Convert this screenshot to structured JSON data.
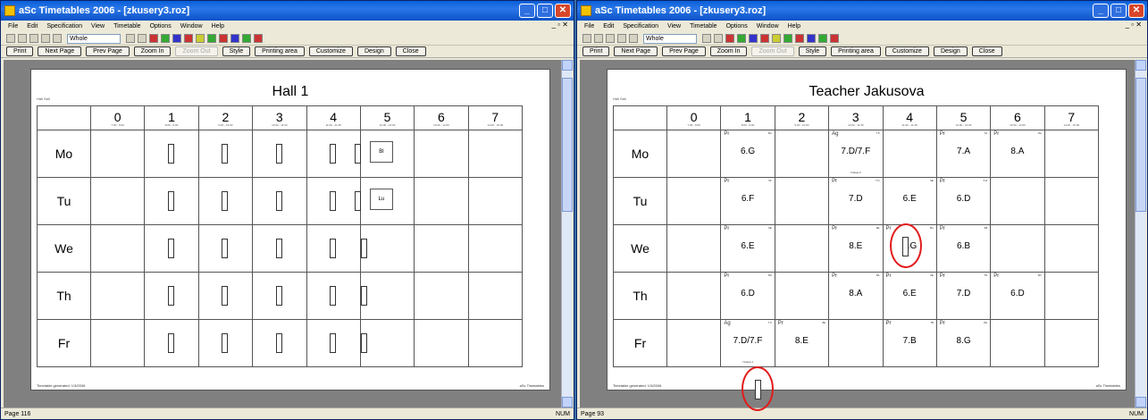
{
  "w1": {
    "title": "aSc Timetables 2006 - [zkusery3.roz]",
    "menu": [
      "File",
      "Edit",
      "Specification",
      "View",
      "Timetable",
      "Options",
      "Window",
      "Help"
    ],
    "combo": "Whole",
    "buttons": [
      "Print",
      "Next Page",
      "Prev Page",
      "Zoom In",
      "Zoom Out",
      "Style",
      "Printing area",
      "Customize",
      "Design",
      "Close"
    ],
    "status_left": "Page 116",
    "status_right": "NUM",
    "page": {
      "title": "Hall 1",
      "subtitle": "Hall Sali",
      "columns": [
        {
          "num": "0",
          "time": "7:00 - 8:00"
        },
        {
          "num": "1",
          "time": "8:00 - 9:00"
        },
        {
          "num": "2",
          "time": "9:00 - 10:00"
        },
        {
          "num": "3",
          "time": "10:00 - 11:00"
        },
        {
          "num": "4",
          "time": "11:00 - 11:45"
        },
        {
          "num": "5",
          "time": "12:00 - 13:00"
        },
        {
          "num": "6",
          "time": "13:00 - 14:00"
        },
        {
          "num": "7",
          "time": "14:00 - 15:00"
        }
      ],
      "rows": [
        {
          "day": "Mo",
          "cells": [
            "",
            "Wi",
            "Mg",
            "Fr",
            "Lp",
            "He",
            "Bl",
            "",
            ""
          ]
        },
        {
          "day": "Tu",
          "cells": [
            "",
            "Gy",
            "Bo",
            "Ch",
            "Mr",
            "Jk",
            "Lu",
            "",
            ""
          ]
        },
        {
          "day": "We",
          "cells": [
            "",
            "Wi",
            "Lp",
            "Mr",
            "Tm",
            "Fe",
            "",
            "",
            ""
          ]
        },
        {
          "day": "Th",
          "cells": [
            "",
            "Hg",
            "Kl",
            "Fr",
            "Bl",
            "Mi",
            "",
            "",
            ""
          ]
        },
        {
          "day": "Fr",
          "cells": [
            "",
            "Bo",
            "Hu",
            "Kl",
            "Sv",
            "Hn",
            "",
            "",
            ""
          ]
        }
      ],
      "footer_left": "Timetable generated: 1/3/2006",
      "footer_right": "aSc Timetables"
    }
  },
  "w2": {
    "title": "aSc Timetables 2006 - [zkusery3.roz]",
    "menu": [
      "File",
      "Edit",
      "Specification",
      "View",
      "Timetable",
      "Options",
      "Window",
      "Help"
    ],
    "combo": "Whole",
    "buttons": [
      "Print",
      "Next Page",
      "Prev Page",
      "Zoom In",
      "Zoom Out",
      "Style",
      "Printing area",
      "Customize",
      "Design",
      "Close"
    ],
    "status_left": "Page 93",
    "status_right": "NUM",
    "page": {
      "title": "Teacher Jakusova",
      "subtitle": "Hall Sali",
      "columns": [
        {
          "num": "0",
          "time": "7:00 - 8:00"
        },
        {
          "num": "1",
          "time": "8:00 - 9:00"
        },
        {
          "num": "2",
          "time": "9:00 - 10:00"
        },
        {
          "num": "3",
          "time": "10:00 - 11:00"
        },
        {
          "num": "4",
          "time": "11:00 - 11:45"
        },
        {
          "num": "5",
          "time": "12:00 - 13:00"
        },
        {
          "num": "6",
          "time": "13:00 - 14:00"
        },
        {
          "num": "7",
          "time": "14:00 - 15:00"
        }
      ],
      "rows": [
        {
          "day": "Mo",
          "cells": [
            {
              "s": "",
              "r": "",
              "c": "",
              "m": ""
            },
            {
              "s": "Pr",
              "r": "6G",
              "c": "6.G",
              "m": ""
            },
            {
              "s": "",
              "r": "",
              "c": "",
              "m": ""
            },
            {
              "s": "Ag",
              "r": "7.5",
              "c": "7.D/7.F",
              "m": "7xskup.2"
            },
            {
              "s": "",
              "r": "",
              "c": "",
              "m": ""
            },
            {
              "s": "Pr",
              "r": "7A",
              "c": "7.A",
              "m": ""
            },
            {
              "s": "Pr",
              "r": "8a",
              "c": "8.A",
              "m": ""
            },
            {
              "s": "",
              "r": "",
              "c": "",
              "m": ""
            }
          ]
        },
        {
          "day": "Tu",
          "cells": [
            {
              "s": "",
              "r": "",
              "c": "",
              "m": ""
            },
            {
              "s": "Pr",
              "r": "6F",
              "c": "6.F",
              "m": ""
            },
            {
              "s": "",
              "r": "",
              "c": "",
              "m": ""
            },
            {
              "s": "Pr",
              "r": "7.D",
              "c": "7.D",
              "m": ""
            },
            {
              "s": "",
              "r": "6E",
              "c": "6.E",
              "m": ""
            },
            {
              "s": "Pr",
              "r": "6.D",
              "c": "6.D",
              "m": ""
            },
            {
              "s": "",
              "r": "",
              "c": "",
              "m": ""
            },
            {
              "s": "",
              "r": "",
              "c": "",
              "m": ""
            }
          ]
        },
        {
          "day": "We",
          "cells": [
            {
              "s": "",
              "r": "",
              "c": "",
              "m": ""
            },
            {
              "s": "Pr",
              "r": "6E",
              "c": "6.E",
              "m": ""
            },
            {
              "s": "",
              "r": "",
              "c": "",
              "m": ""
            },
            {
              "s": "Pr",
              "r": "8E",
              "c": "8.E",
              "m": ""
            },
            {
              "s": "Pr",
              "r": "8G",
              "c": "8.G",
              "m": ""
            },
            {
              "s": "Pr",
              "r": "6B",
              "c": "6.B",
              "m": ""
            },
            {
              "s": "",
              "r": "",
              "c": "",
              "m": ""
            },
            {
              "s": "",
              "r": "",
              "c": "",
              "m": ""
            }
          ]
        },
        {
          "day": "Th",
          "cells": [
            {
              "s": "",
              "r": "",
              "c": "",
              "m": ""
            },
            {
              "s": "Pr",
              "r": "6D",
              "c": "6.D",
              "m": ""
            },
            {
              "s": "",
              "r": "",
              "c": "",
              "m": ""
            },
            {
              "s": "Pr",
              "r": "8A",
              "c": "8.A",
              "m": ""
            },
            {
              "s": "Pr",
              "r": "6E",
              "c": "6.E",
              "m": ""
            },
            {
              "s": "Pr",
              "r": "7D",
              "c": "7.D",
              "m": ""
            },
            {
              "s": "Pr",
              "r": "6D",
              "c": "6.D",
              "m": ""
            },
            {
              "s": "",
              "r": "",
              "c": "",
              "m": ""
            }
          ]
        },
        {
          "day": "Fr",
          "cells": [
            {
              "s": "",
              "r": "",
              "c": "",
              "m": ""
            },
            {
              "s": "Ag",
              "r": "7.5",
              "c": "7.D/7.F",
              "m": "7xskup.1"
            },
            {
              "s": "Pr",
              "r": "8E",
              "c": "8.E",
              "m": ""
            },
            {
              "s": "",
              "r": "",
              "c": "",
              "m": ""
            },
            {
              "s": "Pr",
              "r": "7B",
              "c": "7.B",
              "m": ""
            },
            {
              "s": "Pr",
              "r": "8G",
              "c": "8.G",
              "m": ""
            },
            {
              "s": "",
              "r": "",
              "c": "",
              "m": ""
            },
            {
              "s": "",
              "r": "",
              "c": "",
              "m": ""
            }
          ]
        }
      ],
      "tags": {
        "tu": "Hl",
        "fr": "Hl"
      },
      "footer_left": "Timetable generated: 1/3/2006",
      "footer_right": "aSc Timetables"
    }
  }
}
